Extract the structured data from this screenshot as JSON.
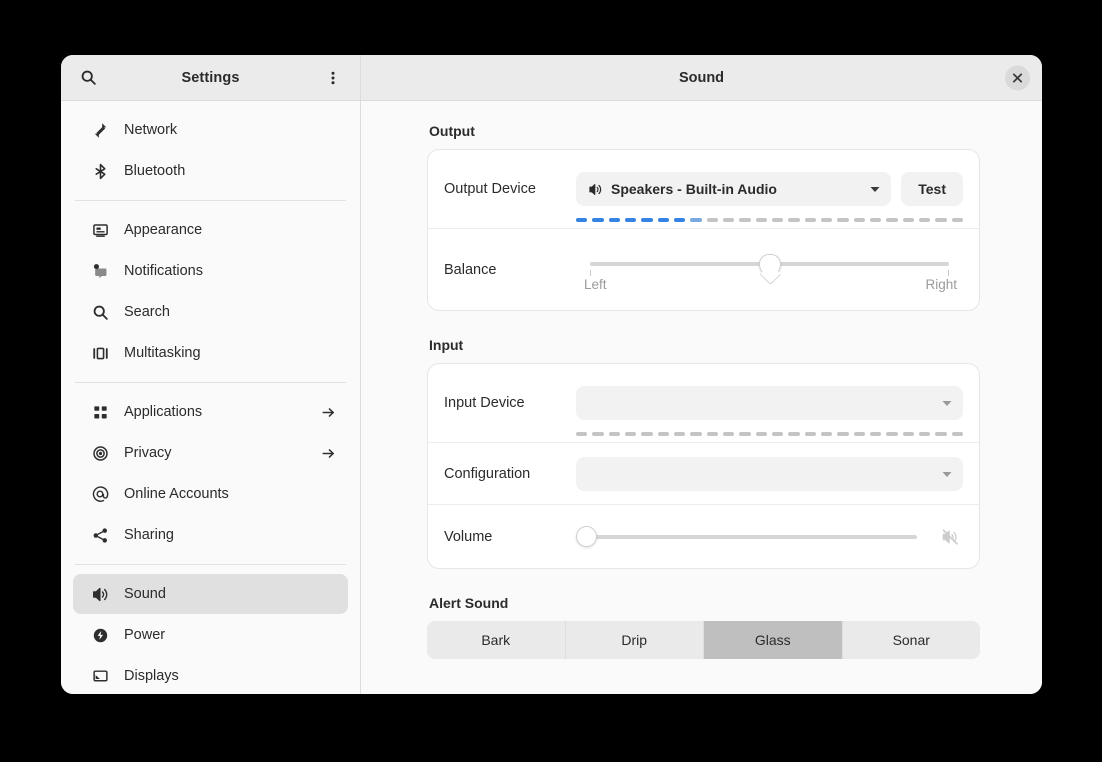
{
  "window": {
    "sidebar_title": "Settings",
    "content_title": "Sound",
    "search_icon": "search-icon",
    "menu_icon": "menu-vertical-dots-icon",
    "close_icon": "close-icon"
  },
  "sidebar": {
    "groups": [
      {
        "items": [
          {
            "label": "Network",
            "icon": "network-icon",
            "arrow": false,
            "selected": false
          },
          {
            "label": "Bluetooth",
            "icon": "bluetooth-icon",
            "arrow": false,
            "selected": false
          }
        ]
      },
      {
        "items": [
          {
            "label": "Appearance",
            "icon": "appearance-icon",
            "arrow": false,
            "selected": false
          },
          {
            "label": "Notifications",
            "icon": "notifications-icon",
            "arrow": false,
            "selected": false
          },
          {
            "label": "Search",
            "icon": "search-icon",
            "arrow": false,
            "selected": false
          },
          {
            "label": "Multitasking",
            "icon": "multitasking-icon",
            "arrow": false,
            "selected": false
          }
        ]
      },
      {
        "items": [
          {
            "label": "Applications",
            "icon": "applications-icon",
            "arrow": true,
            "selected": false
          },
          {
            "label": "Privacy",
            "icon": "privacy-icon",
            "arrow": true,
            "selected": false
          },
          {
            "label": "Online Accounts",
            "icon": "online-accounts-icon",
            "arrow": false,
            "selected": false
          },
          {
            "label": "Sharing",
            "icon": "sharing-icon",
            "arrow": false,
            "selected": false
          }
        ]
      },
      {
        "items": [
          {
            "label": "Sound",
            "icon": "sound-icon",
            "arrow": false,
            "selected": true
          },
          {
            "label": "Power",
            "icon": "power-icon",
            "arrow": false,
            "selected": false
          },
          {
            "label": "Displays",
            "icon": "displays-icon",
            "arrow": false,
            "selected": false
          }
        ]
      }
    ]
  },
  "main": {
    "output": {
      "title": "Output",
      "device_label": "Output Device",
      "device_value": "Speakers - Built-in Audio",
      "device_icon": "speaker-icon",
      "test_label": "Test",
      "level_meter": {
        "segments": 24,
        "filled": 7,
        "partial": 1,
        "color_on": "#3584e4",
        "color_half": "#7aa9e0",
        "color_off": "#c4c4c4"
      },
      "balance_label": "Balance",
      "balance_left_label": "Left",
      "balance_right_label": "Right",
      "balance_value_percent": 50
    },
    "input": {
      "title": "Input",
      "device_label": "Input Device",
      "device_value": "",
      "level_meter": {
        "segments": 24,
        "filled": 0,
        "partial": 0
      },
      "configuration_label": "Configuration",
      "configuration_value": "",
      "volume_label": "Volume",
      "volume_value_percent": 0,
      "volume_mute_icon": "speaker-muted-icon"
    },
    "alert_sound": {
      "title": "Alert Sound",
      "options": [
        {
          "label": "Bark",
          "selected": false
        },
        {
          "label": "Drip",
          "selected": false
        },
        {
          "label": "Glass",
          "selected": true
        },
        {
          "label": "Sonar",
          "selected": false
        }
      ]
    }
  }
}
